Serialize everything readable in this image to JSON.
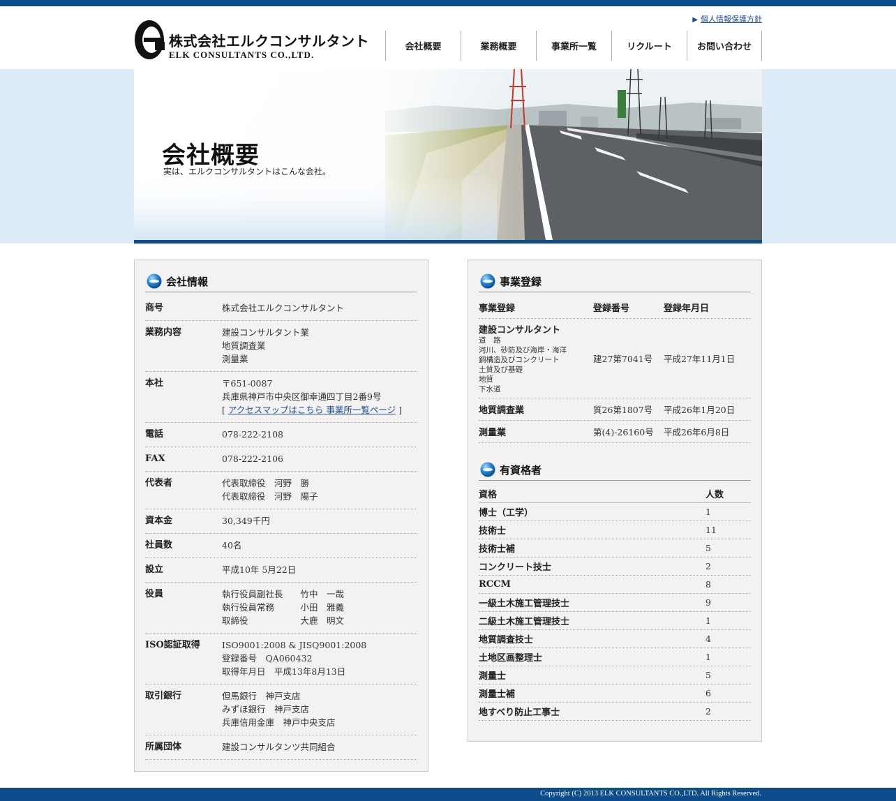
{
  "header": {
    "logo_jp": "株式会社エルクコンサルタント",
    "logo_en": "ELK CONSULTANTS CO.,LTD.",
    "privacy_link": "個人情報保護方針",
    "nav": [
      "会社概要",
      "業務概要",
      "事業所一覧",
      "リクルート",
      "お問い合わせ"
    ]
  },
  "hero": {
    "title": "会社概要",
    "subtitle": "実は、エルクコンサルタントはこんな会社。"
  },
  "company": {
    "section_title": "会社情報",
    "rows": [
      {
        "label": "商号",
        "lines": [
          "株式会社エルクコンサルタント"
        ]
      },
      {
        "label": "業務内容",
        "lines": [
          "建設コンサルタント業",
          "地質調査業",
          "測量業"
        ]
      },
      {
        "label": "本社",
        "lines": [
          "〒651-0087",
          "兵庫県神戸市中央区御幸通四丁目2番9号"
        ],
        "link_prefix": "[ ",
        "link_text": "アクセスマップはこちら 事業所一覧ページ",
        "link_suffix": " ]"
      },
      {
        "label": "電話",
        "lines": [
          "078-222-2108"
        ]
      },
      {
        "label": "FAX",
        "lines": [
          "078-222-2106"
        ]
      },
      {
        "label": "代表者",
        "lines": [
          "代表取締役　河野　勝",
          "代表取締役　河野　陽子"
        ]
      },
      {
        "label": "資本金",
        "lines": [
          "30,349千円"
        ]
      },
      {
        "label": "社員数",
        "lines": [
          "40名"
        ]
      },
      {
        "label": "設立",
        "lines": [
          "平成10年 5月22日"
        ]
      },
      {
        "label": "役員",
        "lines": [
          "執行役員副社長　　竹中　一哉",
          "執行役員常務　　　小田　雅義",
          "取締役　　　　　　大鹿　明文"
        ]
      },
      {
        "label": "ISO認証取得",
        "lines": [
          "ISO9001:2008 & JISQ9001:2008",
          "登録番号　QA060432",
          "取得年月日　平成13年8月13日"
        ]
      },
      {
        "label": "取引銀行",
        "lines": [
          "但馬銀行　神戸支店",
          "みずほ銀行　神戸支店",
          "兵庫信用金庫　神戸中央支店"
        ]
      },
      {
        "label": "所属団体",
        "lines": [
          "建設コンサルタンツ共同組合"
        ]
      }
    ]
  },
  "registration": {
    "section_title": "事業登録",
    "headers": [
      "事業登録",
      "登録番号",
      "登録年月日"
    ],
    "rows": [
      {
        "name": "建設コンサルタント",
        "subs": [
          "道　路",
          "河川、砂防及び海岸・海洋",
          "鋼構造及びコンクリート",
          "土質及び基礎",
          "地質",
          "下水道"
        ],
        "number": "建27第7041号",
        "date": "平成27年11月1日"
      },
      {
        "name": "地質調査業",
        "subs": [],
        "number": "質26第1807号",
        "date": "平成26年1月20日"
      },
      {
        "name": "測量業",
        "subs": [],
        "number": "第(4)-26160号",
        "date": "平成26年6月8日"
      }
    ]
  },
  "qualifications": {
    "section_title": "有資格者",
    "headers": [
      "資格",
      "人数"
    ],
    "rows": [
      {
        "name": "博士（工学）",
        "count": "1"
      },
      {
        "name": "技術士",
        "count": "11"
      },
      {
        "name": "技術士補",
        "count": "5"
      },
      {
        "name": "コンクリート技士",
        "count": "2"
      },
      {
        "name": "RCCM",
        "count": "8"
      },
      {
        "name": "一級土木施工管理技士",
        "count": "9"
      },
      {
        "name": "二級土木施工管理技士",
        "count": "1"
      },
      {
        "name": "地質調査技士",
        "count": "4"
      },
      {
        "name": "土地区画整理士",
        "count": "1"
      },
      {
        "name": "測量士",
        "count": "5"
      },
      {
        "name": "測量士補",
        "count": "6"
      },
      {
        "name": "地すべり防止工事士",
        "count": "2"
      }
    ]
  },
  "footer": {
    "copyright": "Copyright (C) 2013 ELK CONSULTANTS CO.,LTD. All Rights Reserved."
  }
}
